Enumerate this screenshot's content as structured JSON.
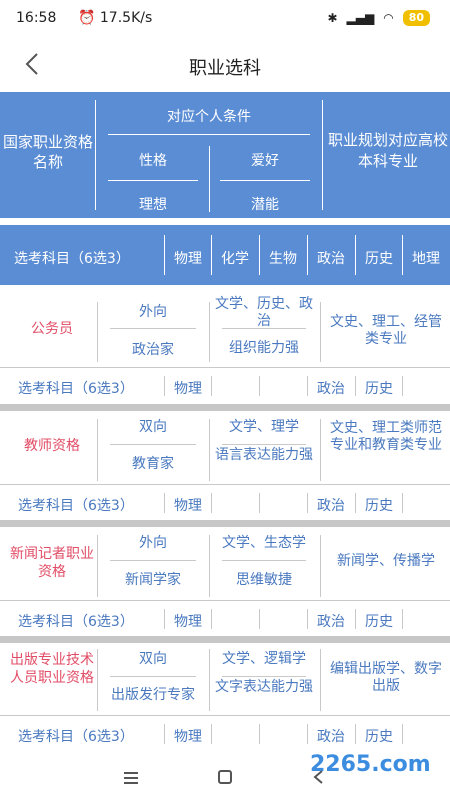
{
  "status": {
    "time": "16:58",
    "speed": "17.5K/s",
    "battery": "80"
  },
  "nav": {
    "title": "职业选科"
  },
  "header": {
    "cert_name": "国家职业资格名称",
    "conditions": "对应个人条件",
    "personality": "性格",
    "hobby": "爱好",
    "ideal": "理想",
    "potential": "潜能",
    "major": "职业规划对应高校本科专业"
  },
  "subjects_header": {
    "label": "选考科目（6选3）",
    "subjects": [
      "物理",
      "化学",
      "生物",
      "政治",
      "历史",
      "地理"
    ]
  },
  "rows": [
    {
      "name": "公务员",
      "personality": "外向",
      "ideal": "政治家",
      "hobby": "文学、历史、政治",
      "potential": "组织能力强",
      "major": "文史、理工、经管类专业",
      "sel_label": "选考科目（6选3）",
      "sel": [
        "物理",
        "",
        "",
        "政治",
        "历史",
        ""
      ]
    },
    {
      "name": "教师资格",
      "personality": "双向",
      "ideal": "教育家",
      "hobby": "文学、理学",
      "potential": "语言表达能力强",
      "major": "文史、理工类师范专业和教育类专业",
      "sel_label": "选考科目（6选3）",
      "sel": [
        "物理",
        "",
        "",
        "政治",
        "历史",
        ""
      ]
    },
    {
      "name": "新闻记者职业资格",
      "personality": "外向",
      "ideal": "新闻学家",
      "hobby": "文学、生态学",
      "potential": "思维敏捷",
      "major": "新闻学、传播学",
      "sel_label": "选考科目（6选3）",
      "sel": [
        "物理",
        "",
        "",
        "政治",
        "历史",
        ""
      ]
    },
    {
      "name": "出版专业技术人员职业资格",
      "personality": "双向",
      "ideal": "出版发行专家",
      "hobby": "文学、逻辑学",
      "potential": "文字表达能力强",
      "major": "编辑出版学、数字出版",
      "sel_label": "选考科目（6选3）",
      "sel": [
        "物理",
        "",
        "",
        "政治",
        "历史",
        ""
      ]
    }
  ],
  "watermark": "2265.com"
}
